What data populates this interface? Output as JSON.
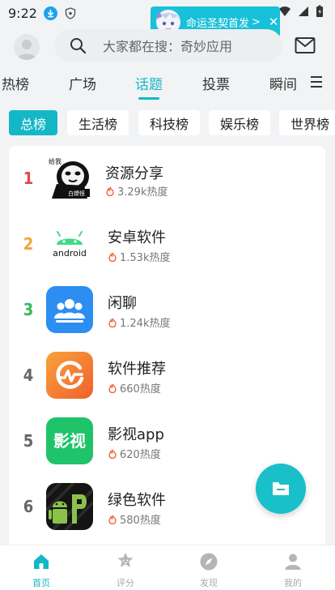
{
  "status_bar": {
    "time": "9:22"
  },
  "promo": {
    "text": "命运圣契首发",
    "arrow": ">",
    "close": "✕"
  },
  "header": {
    "search_placeholder": "大家都在搜：奇妙应用"
  },
  "tabs": [
    {
      "label": "热榜"
    },
    {
      "label": "广场"
    },
    {
      "label": "话题",
      "active": true
    },
    {
      "label": "投票"
    },
    {
      "label": "瞬间"
    }
  ],
  "chips": [
    {
      "label": "总榜",
      "active": true
    },
    {
      "label": "生活榜"
    },
    {
      "label": "科技榜"
    },
    {
      "label": "娱乐榜"
    },
    {
      "label": "世界榜"
    }
  ],
  "list": [
    {
      "rank": "1",
      "name": "资源分享",
      "heat": "3.29k热度",
      "rank_color": "#e2474b",
      "icon": "panda-meme-icon",
      "icon_text_top": "给我",
      "icon_text_bottom": "白嫖怪"
    },
    {
      "rank": "2",
      "name": "安卓软件",
      "heat": "1.53k热度",
      "rank_color": "#f2a33a",
      "icon": "android-logo-icon",
      "icon_text": "android"
    },
    {
      "rank": "3",
      "name": "闲聊",
      "heat": "1.24k热度",
      "rank_color": "#3bb55a",
      "icon": "group-chat-icon"
    },
    {
      "rank": "4",
      "name": "软件推荐",
      "heat": "660热度",
      "rank_color": "#666666",
      "icon": "recommend-logo-icon"
    },
    {
      "rank": "5",
      "name": "影视app",
      "heat": "620热度",
      "rank_color": "#666666",
      "icon": "film-app-icon",
      "icon_text": "影视"
    },
    {
      "rank": "6",
      "name": "绿色软件",
      "heat": "580热度",
      "rank_color": "#666666",
      "icon": "green-software-icon"
    }
  ],
  "bottom_nav": [
    {
      "label": "首页",
      "active": true,
      "icon": "home-icon"
    },
    {
      "label": "评分",
      "icon": "rating-icon"
    },
    {
      "label": "发现",
      "icon": "compass-icon"
    },
    {
      "label": "我的",
      "icon": "profile-icon"
    }
  ],
  "colors": {
    "accent": "#13b7c6",
    "background": "#f1f3f5"
  }
}
